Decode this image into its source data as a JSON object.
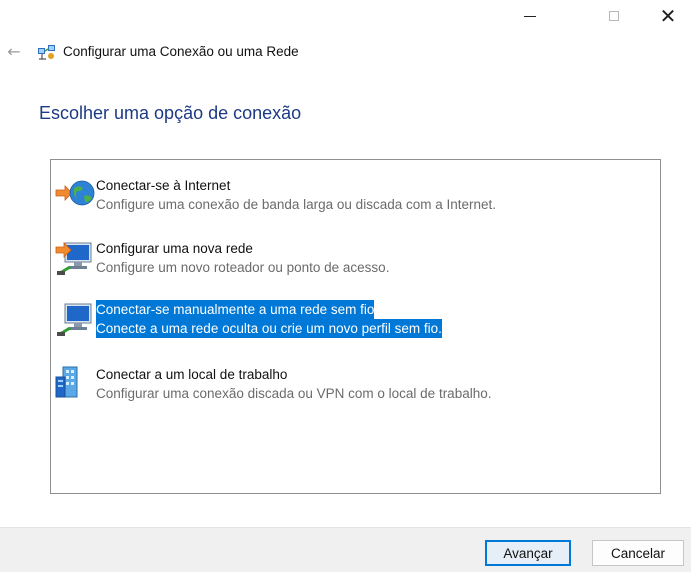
{
  "window": {
    "minimize_icon": "minimize-icon",
    "maximize_icon": "maximize-icon",
    "close_icon": "close-icon",
    "close_glyph": "✕"
  },
  "header": {
    "back_glyph": "←",
    "title": "Configurar uma Conexão ou uma Rede",
    "icon": "network-setup-icon"
  },
  "page": {
    "heading": "Escolher uma opção de conexão"
  },
  "options": [
    {
      "title": "Conectar-se à Internet",
      "description": "Configure uma conexão de banda larga ou discada com a Internet.",
      "icon": "internet-globe-icon",
      "selected": false
    },
    {
      "title": "Configurar uma nova rede",
      "description": "Configure um novo roteador ou ponto de acesso.",
      "icon": "new-network-icon",
      "selected": false
    },
    {
      "title": "Conectar-se manualmente a uma rede sem fio",
      "description": "Conecte a uma rede oculta ou crie um novo perfil sem fio.",
      "icon": "wireless-network-icon",
      "selected": true
    },
    {
      "title": "Conectar a um local de trabalho",
      "description": "Configurar uma conexão discada ou VPN com o local de trabalho.",
      "icon": "workplace-icon",
      "selected": false
    }
  ],
  "footer": {
    "next_label": "Avançar",
    "cancel_label": "Cancelar"
  },
  "colors": {
    "heading": "#1c3a85",
    "selection": "#0078d7",
    "description": "#6b6b6b"
  }
}
